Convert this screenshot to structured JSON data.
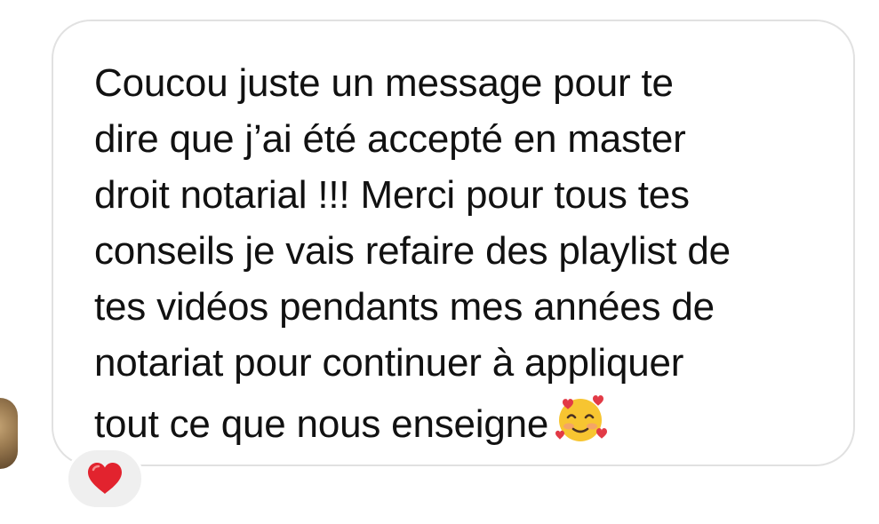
{
  "message": {
    "lines": [
      "Coucou juste un message pour te",
      "dire que j’ai été accepté en master",
      "droit notarial !!! Merci pour tous tes",
      "conseils je vais refaire des playlist de",
      "tes vidéos pendants mes années de",
      "notariat pour continuer à appliquer",
      "tout ce que nous enseigne"
    ],
    "trailing_emoji": "smiling-face-with-hearts-icon"
  },
  "reaction": {
    "icon": "red-heart-icon",
    "color": "#e2232e"
  },
  "colors": {
    "bubble_border": "#e1e1e1",
    "text": "#111111",
    "reaction_background": "#efefef"
  }
}
